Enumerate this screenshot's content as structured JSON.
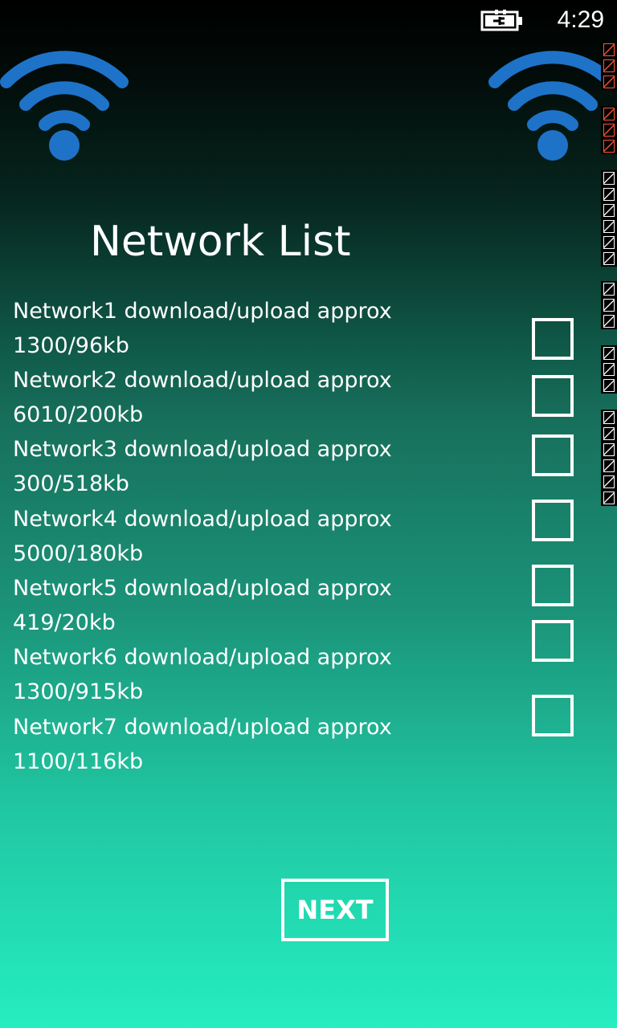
{
  "status_bar": {
    "time": "4:29",
    "battery_icon": "battery-charging-icon"
  },
  "icons": {
    "wifi_left": "wifi-icon",
    "wifi_right": "wifi-icon",
    "wifi_color": "#1e73c8"
  },
  "title": "Network List",
  "networks": [
    {
      "name": "Network1",
      "line1": "Network1 download/upload approx",
      "line2": "1300/96kb",
      "checked": false
    },
    {
      "name": "Network2",
      "line1": "Network2 download/upload approx",
      "line2": "6010/200kb",
      "checked": false
    },
    {
      "name": "Network3",
      "line1": "Network3 download/upload approx",
      "line2": "300/518kb",
      "checked": false
    },
    {
      "name": "Network4",
      "line1": "Network4 download/upload approx",
      "line2": "5000/180kb",
      "checked": false
    },
    {
      "name": "Network5",
      "line1": "Network5 download/upload approx",
      "line2": "419/20kb",
      "checked": false
    },
    {
      "name": "Network6",
      "line1": "Network6 download/upload approx",
      "line2": "1300/915kb",
      "checked": false
    },
    {
      "name": "Network7",
      "line1": "Network7 download/upload approx",
      "line2": "1100/116kb",
      "checked": false
    }
  ],
  "next_button": {
    "label": "NEXT"
  },
  "colors": {
    "text": "#ffffff",
    "gradient_top": "#000000",
    "gradient_bottom": "#25eec1"
  }
}
